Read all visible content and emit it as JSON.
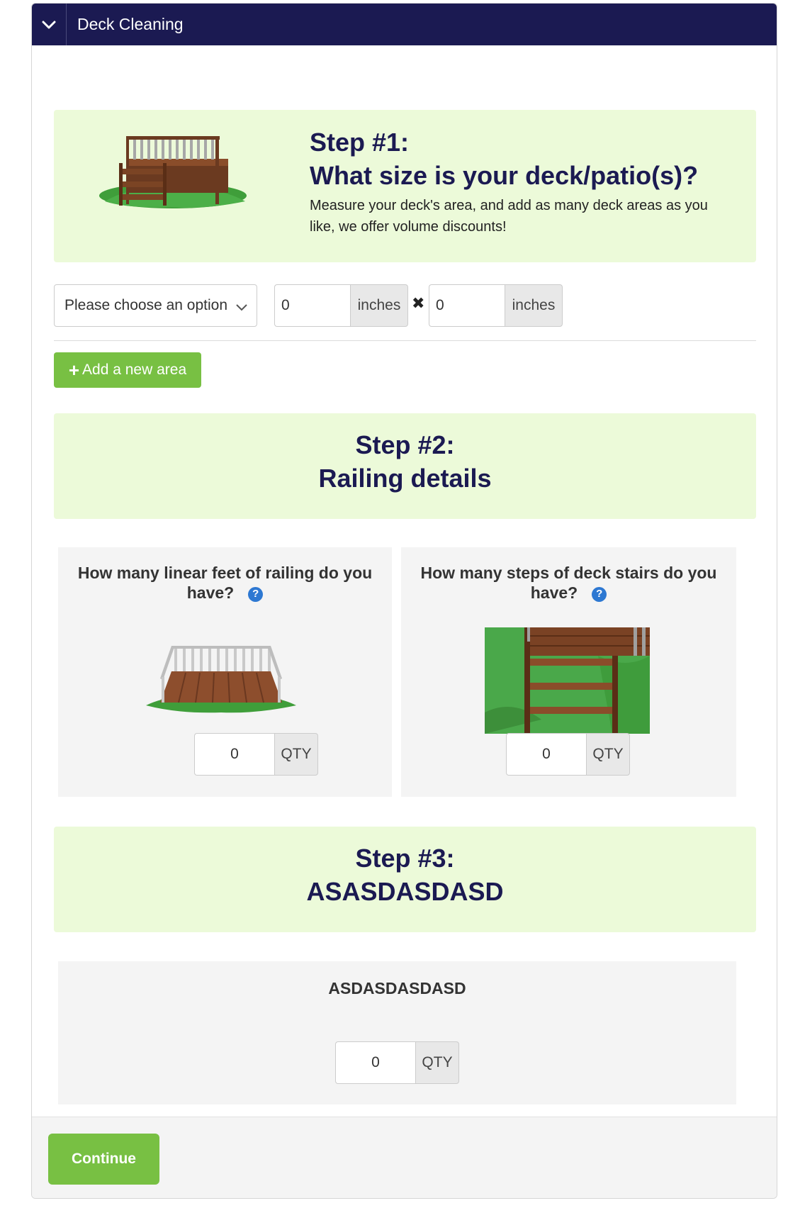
{
  "header": {
    "title": "Deck Cleaning",
    "toggle_icon": "chevron-down-icon"
  },
  "step1": {
    "heading_line1": "Step #1:",
    "heading_line2": "What size is your deck/patio(s)?",
    "description": "Measure your deck's area, and add as many deck areas as you like, we offer volume discounts!",
    "select": {
      "selected": "Please choose an option"
    },
    "width": {
      "value": "0",
      "unit": "inches"
    },
    "length": {
      "value": "0",
      "unit": "inches"
    },
    "times_symbol": "✖",
    "add_button": {
      "icon": "+",
      "label": "Add a new area"
    }
  },
  "step2": {
    "heading_line1": "Step #2:",
    "heading_line2": "Railing details",
    "railing": {
      "question": "How many linear feet of railing do you have?",
      "value": "0",
      "unit": "QTY"
    },
    "stairs": {
      "question": "How many steps of deck stairs do you have?",
      "value": "0",
      "unit": "QTY"
    }
  },
  "step3": {
    "heading_line1": "Step #3:",
    "heading_line2": "ASASDASDASD",
    "item": {
      "question": "ASDASDASDASD",
      "value": "0",
      "unit": "QTY"
    }
  },
  "footer": {
    "continue_label": "Continue"
  },
  "colors": {
    "header_bg": "#1b1a52",
    "banner_bg": "#ecfad9",
    "heading": "#1b1a52",
    "button_green": "#78c043",
    "help_blue": "#2d78d2"
  }
}
